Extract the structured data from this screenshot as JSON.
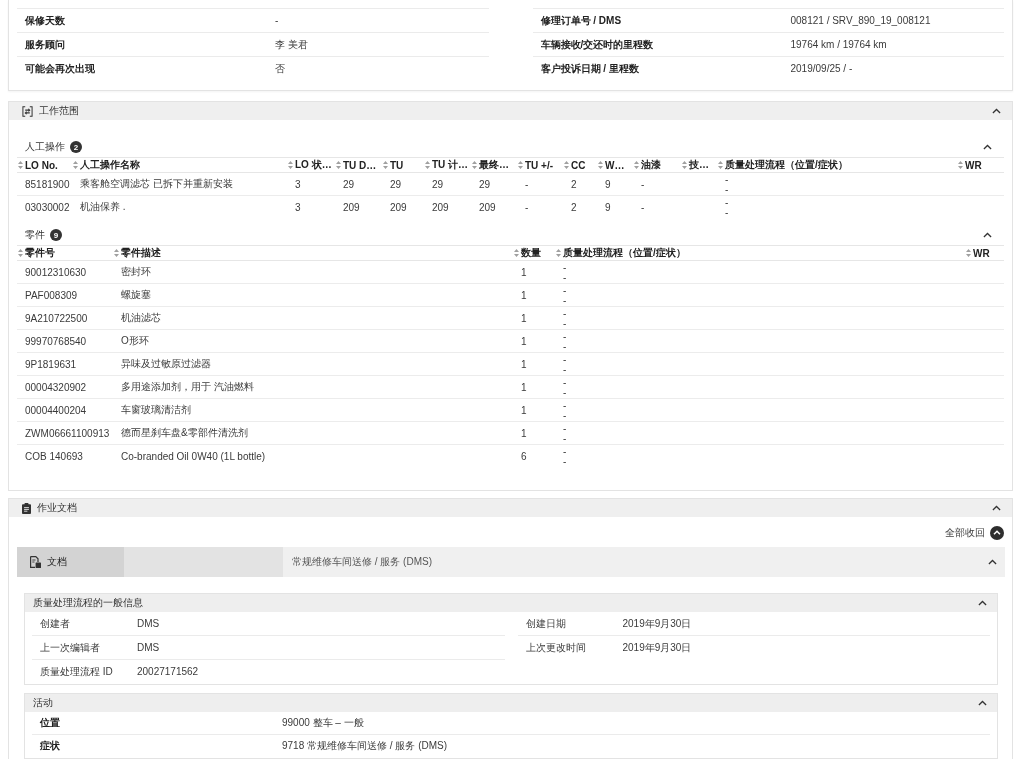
{
  "vehicle_info": {
    "left": [
      {
        "label": "保修天数",
        "value": "-"
      },
      {
        "label": "服务顾问",
        "value": "李 美君"
      },
      {
        "label": "可能会再次出现",
        "value": "否"
      }
    ],
    "right": [
      {
        "label": "修理订单号 / DMS",
        "value": "008121 / SRV_890_19_008121"
      },
      {
        "label": "车辆接收/交还时的里程数",
        "value": "19764 km / 19764 km"
      },
      {
        "label": "客户投诉日期 / 里程数",
        "value": "2019/09/25 / -"
      }
    ]
  },
  "work_scope": {
    "title": "工作范围",
    "expanded": true,
    "labor": {
      "title": "人工操作",
      "count": "2",
      "expanded": true,
      "columns": [
        "LO No.",
        "人工操作名称",
        "LO 状…",
        "TU D…",
        "TU",
        "TU 计…",
        "最终…",
        "TU +/-",
        "CC",
        "W…",
        "油漆",
        "技…",
        "质量处理流程（位置/症状）",
        "WR"
      ],
      "rows": [
        {
          "cells": [
            "85181900",
            "乘客舱空调滤芯 已拆下并重新安装",
            "3",
            "29",
            "29",
            "29",
            "29",
            "-",
            "2",
            "9",
            "-"
          ],
          "qm": [
            "-",
            "-"
          ]
        },
        {
          "cells": [
            "03030002",
            "机油保养 .",
            "3",
            "209",
            "209",
            "209",
            "209",
            "-",
            "2",
            "9",
            "-"
          ],
          "qm": [
            "-",
            "-"
          ]
        }
      ]
    },
    "parts": {
      "title": "零件",
      "count": "9",
      "expanded": true,
      "columns": [
        "零件号",
        "零件描述",
        "数量",
        "质量处理流程（位置/症状）",
        "WR"
      ],
      "rows": [
        {
          "cells": [
            "90012310630",
            "密封环",
            "1"
          ],
          "qm": [
            "-",
            "-"
          ]
        },
        {
          "cells": [
            "PAF008309",
            "螺旋塞",
            "1"
          ],
          "qm": [
            "-",
            "-"
          ]
        },
        {
          "cells": [
            "9A210722500",
            "机油滤芯",
            "1"
          ],
          "qm": [
            "-",
            "-"
          ]
        },
        {
          "cells": [
            "99970768540",
            "O形环",
            "1"
          ],
          "qm": [
            "-",
            "-"
          ]
        },
        {
          "cells": [
            "9P1819631",
            "异味及过敏原过滤器",
            "1"
          ],
          "qm": [
            "-",
            "-"
          ]
        },
        {
          "cells": [
            "00004320902",
            "多用途添加剂，用于 汽油燃料",
            "1"
          ],
          "qm": [
            "-",
            "-"
          ]
        },
        {
          "cells": [
            "00004400204",
            "车窗玻璃清洁剂",
            "1"
          ],
          "qm": [
            "-",
            "-"
          ]
        },
        {
          "cells": [
            "ZWM06661100913",
            "德而星刹车盘&零部件清洗剂",
            "1"
          ],
          "qm": [
            "-",
            "-"
          ]
        },
        {
          "cells": [
            "COB 140693",
            "Co-branded Oil 0W40 (1L bottle)",
            "6"
          ],
          "qm": [
            "-",
            "-"
          ]
        }
      ]
    }
  },
  "documentation": {
    "title": "作业文档",
    "expanded": true,
    "collapse_all": "全部收回",
    "document": {
      "tab": "文档",
      "title": "常规维修车间送修 / 服务 (DMS)",
      "expanded": true,
      "general_info": {
        "title": "质量处理流程的一般信息",
        "expanded": true,
        "left": [
          {
            "label": "创建者",
            "value": "DMS"
          },
          {
            "label": "上一次编辑者",
            "value": "DMS"
          },
          {
            "label": "质量处理流程 ID",
            "value": "20027171562"
          }
        ],
        "right": [
          {
            "label": "创建日期",
            "value": "2019年9月30日"
          },
          {
            "label": "上次更改时间",
            "value": "2019年9月30日"
          }
        ]
      },
      "activity": {
        "title": "活动",
        "expanded": true,
        "rows": [
          {
            "label": "位置",
            "value": "99000 整车 – 一般"
          },
          {
            "label": "症状",
            "value": "9718 常规维修车间送修 / 服务 (DMS)"
          }
        ]
      }
    }
  }
}
